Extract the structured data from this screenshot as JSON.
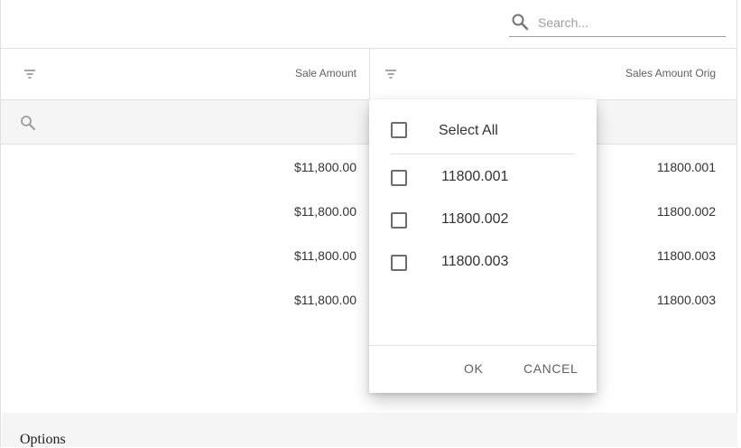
{
  "search": {
    "placeholder": "Search..."
  },
  "columns": [
    {
      "label": "Sale Amount"
    },
    {
      "label": "Sales Amount Orig"
    }
  ],
  "rows": [
    {
      "sale_amount": "$11,800.00",
      "sales_amount_orig": "11800.001"
    },
    {
      "sale_amount": "$11,800.00",
      "sales_amount_orig": "11800.002"
    },
    {
      "sale_amount": "$11,800.00",
      "sales_amount_orig": "11800.003"
    },
    {
      "sale_amount": "$11,800.00",
      "sales_amount_orig": "11800.003"
    }
  ],
  "filter_popup": {
    "select_all": "Select All",
    "options": [
      "11800.001",
      "11800.002",
      "11800.003"
    ],
    "ok": "OK",
    "cancel": "CANCEL"
  },
  "footer": {
    "options_label": "Options"
  },
  "icons": {
    "search": "search-icon",
    "filter": "filter-icon"
  },
  "colors": {
    "border": "#e0e0e0",
    "filter_row_bg": "#f5f5f5",
    "button_text": "#616161"
  }
}
